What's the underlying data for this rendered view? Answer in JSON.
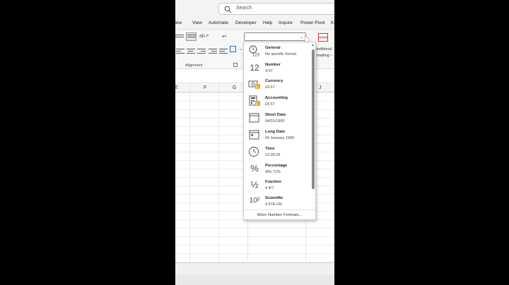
{
  "search": {
    "placeholder": "Search"
  },
  "tabs": [
    "rview",
    "View",
    "Automate",
    "Developer",
    "Help",
    "Inquire",
    "Power Pivot",
    "Ka"
  ],
  "ribbon": {
    "alignment_label": "Alignment",
    "conditional_formatting_line1": "onditional",
    "conditional_formatting_line2": "rmatting ~"
  },
  "columns": [
    "E",
    "F",
    "G",
    "J"
  ],
  "number_format_menu": {
    "items": [
      {
        "label": "General",
        "sample": "No specific format",
        "icon": "clock-123-icon"
      },
      {
        "label": "Number",
        "sample": "4.57",
        "icon": "number-12-icon"
      },
      {
        "label": "Currency",
        "sample": "£4.57",
        "icon": "currency-icon"
      },
      {
        "label": "Accounting",
        "sample": "£4.57",
        "icon": "accounting-calculator-icon"
      },
      {
        "label": "Short Date",
        "sample": "04/01/1900",
        "icon": "calendar-icon"
      },
      {
        "label": "Long Date",
        "sample": "04 January 1900",
        "icon": "calendar-icon"
      },
      {
        "label": "Time",
        "sample": "13:36:39",
        "icon": "clock-icon"
      },
      {
        "label": "Percentage",
        "sample": "456.71%",
        "icon": "percent-icon"
      },
      {
        "label": "Fraction",
        "sample": "4 4/7",
        "icon": "fraction-icon"
      },
      {
        "label": "Scientific",
        "sample": "4.57E+00",
        "icon": "scientific-icon"
      }
    ],
    "more": "More Number Formats..."
  },
  "glyphs": {
    "number": "12",
    "percent": "%",
    "fraction": "½",
    "scientific": "10²"
  }
}
